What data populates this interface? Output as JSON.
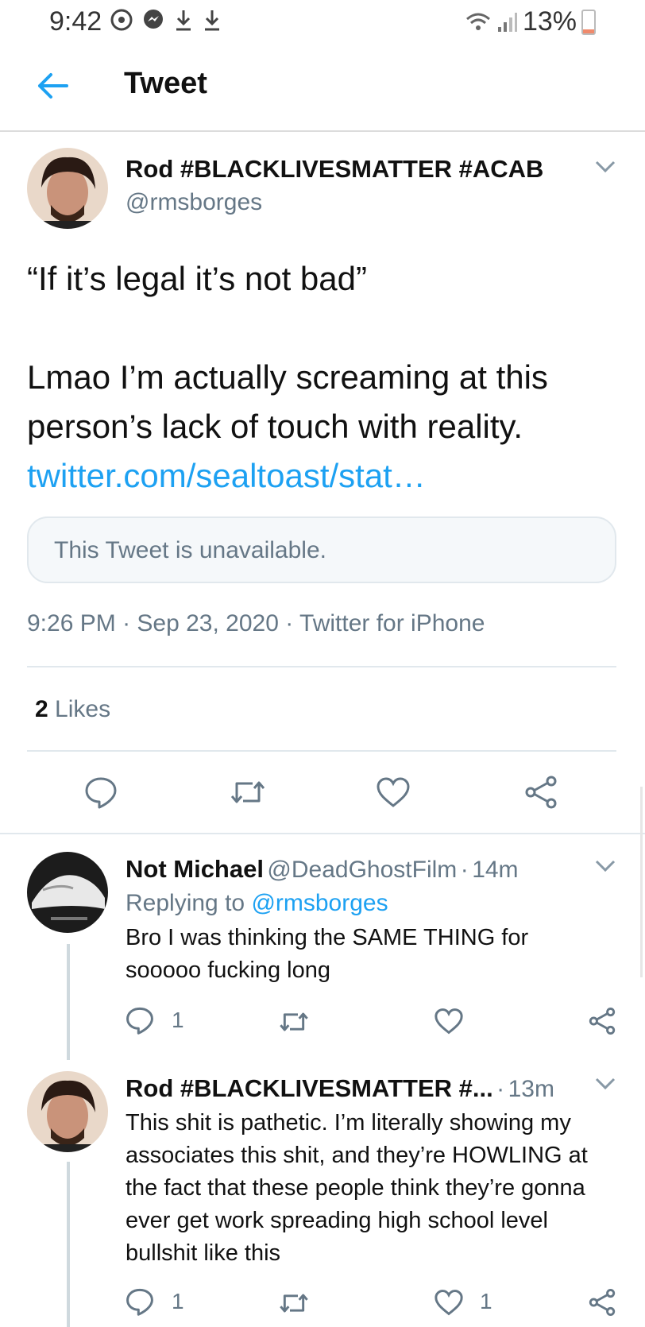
{
  "status_bar": {
    "time": "9:42",
    "battery": "13%"
  },
  "header": {
    "title": "Tweet"
  },
  "main_tweet": {
    "author_name": "Rod #BLACKLIVESMATTER #ACAB",
    "handle": "@rmsborges",
    "text_line1": "“If it’s legal it’s not bad”",
    "text_line2": "Lmao I’m actually screaming at this person’s lack of touch with reality.",
    "link_text": "twitter.com/sealtoast/stat…",
    "quoted_unavailable": "This Tweet is unavailable.",
    "time": "9:26 PM",
    "date": "Sep 23, 2020",
    "source": "Twitter for iPhone",
    "likes_count": "2",
    "likes_label": "Likes"
  },
  "replies": [
    {
      "author_name": "Not Michael",
      "handle": "@DeadGhostFilm",
      "age": "14m",
      "replying_prefix": "Replying to",
      "replying_to": "@rmsborges",
      "text": "Bro I was thinking the SAME THING for sooooo fucking long",
      "reply_count": "1",
      "retweet_count": "",
      "like_count": ""
    },
    {
      "author_name": "Rod #BLACKLIVESMATTER #...",
      "handle": "",
      "age": "13m",
      "text": "This shit is pathetic. I’m literally showing my associates this shit, and they’re HOWLING at the fact that these people think they’re gonna ever get work spreading high school level bullshit like this",
      "reply_count": "1",
      "retweet_count": "",
      "like_count": "1"
    }
  ],
  "icons": {
    "back": "arrow-left-icon",
    "chevron": "chevron-down-icon",
    "reply": "reply-icon",
    "retweet": "retweet-icon",
    "like": "heart-icon",
    "share": "share-icon"
  },
  "colors": {
    "link": "#1da1f2",
    "secondary_text": "#657786",
    "divider": "#e1e8ed"
  }
}
